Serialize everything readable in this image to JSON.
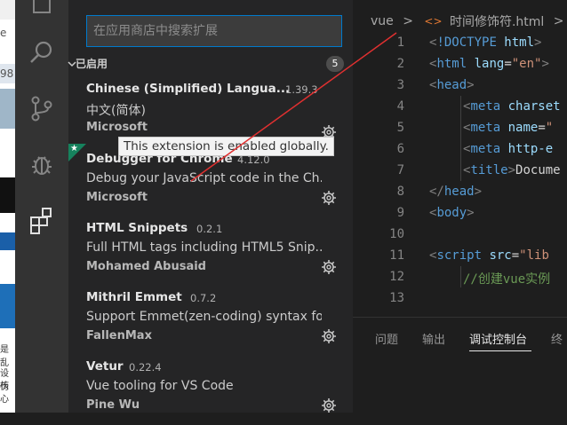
{
  "left_strip": {
    "fragments": [
      "e",
      "98",
      "是乱",
      "设伪",
      "核心"
    ]
  },
  "activity_bar": {
    "icons": [
      "files-icon",
      "search-icon",
      "source-control-icon",
      "debug-icon",
      "extensions-icon"
    ]
  },
  "sidebar": {
    "search_placeholder": "在应用商店中搜索扩展",
    "section_title": "已启用",
    "section_count": "5",
    "extensions": [
      {
        "name": "Chinese (Simplified) Langua...",
        "version": "1.39.3",
        "description": "中文(简体)",
        "publisher": "Microsoft"
      },
      {
        "name": "Debugger for Chrome",
        "version": "4.12.0",
        "description": "Debug your JavaScript code in the Ch...",
        "publisher": "Microsoft"
      },
      {
        "name": "HTML Snippets",
        "version": "0.2.1",
        "description": "Full HTML tags including HTML5 Snip...",
        "publisher": "Mohamed Abusaid"
      },
      {
        "name": "Mithril Emmet",
        "version": "0.7.2",
        "description": "Support Emmet(zen-coding) syntax fo...",
        "publisher": "FallenMax"
      },
      {
        "name": "Vetur",
        "version": "0.22.4",
        "description": "Vue tooling for VS Code",
        "publisher": "Pine Wu"
      }
    ],
    "tooltip": "This extension is enabled globally."
  },
  "editor": {
    "breadcrumb": {
      "folder": "vue",
      "separator": ">",
      "file_icon": "<>",
      "file": "时间修饰符.html",
      "tail": ">"
    },
    "line_numbers": [
      "1",
      "2",
      "3",
      "4",
      "5",
      "6",
      "7",
      "8",
      "9",
      "10",
      "11",
      "12",
      "13"
    ],
    "code": {
      "l1_a": "<",
      "l1_b": "!DOCTYPE",
      "l1_c": " html",
      "l1_d": ">",
      "l2_a": "<",
      "l2_b": "html",
      "l2_c": " lang",
      "l2_d": "=",
      "l2_e": "\"en\"",
      "l2_f": ">",
      "l3_a": "<",
      "l3_b": "head",
      "l3_c": ">",
      "l4_a": "<",
      "l4_b": "meta",
      "l4_c": " charset",
      "l5_a": "<",
      "l5_b": "meta",
      "l5_c": " name",
      "l5_d": "=",
      "l5_e": "\"",
      "l6_a": "<",
      "l6_b": "meta",
      "l6_c": " http-e",
      "l7_a": "<",
      "l7_b": "title",
      "l7_c": ">",
      "l7_d": "Docume",
      "l8_a": "</",
      "l8_b": "head",
      "l8_c": ">",
      "l9_a": "<",
      "l9_b": "body",
      "l9_c": ">",
      "l11_a": "<",
      "l11_b": "script",
      "l11_c": " src",
      "l11_d": "=",
      "l11_e": "\"lib",
      "l12_a": "//创建vue实例"
    }
  },
  "panel": {
    "tabs": [
      "问题",
      "输出",
      "调试控制台",
      "终"
    ],
    "active_tab": "调试控制台"
  },
  "colors": {
    "accent": "#007acc",
    "annotation_line": "#e03030",
    "enabled_star": "#16825d"
  }
}
